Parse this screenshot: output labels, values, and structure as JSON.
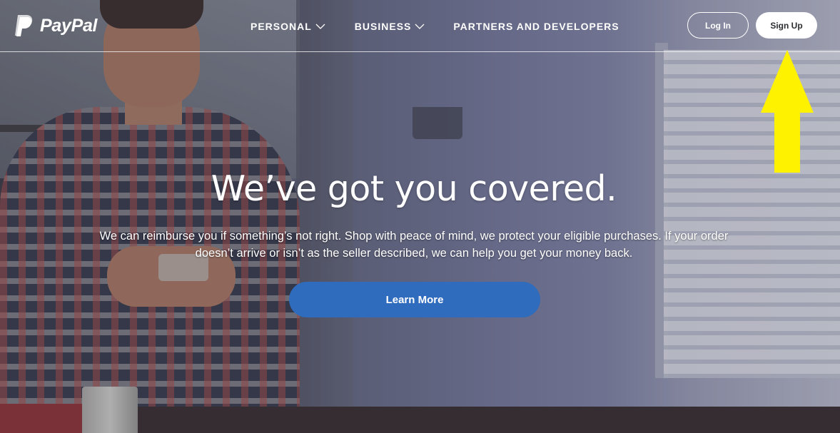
{
  "header": {
    "logo_text": "PayPal",
    "nav": {
      "personal": "PERSONAL",
      "business": "BUSINESS",
      "partners": "PARTNERS AND DEVELOPERS"
    },
    "login_label": "Log In",
    "signup_label": "Sign Up"
  },
  "hero": {
    "title": "We’ve got you covered.",
    "body": "We can reimburse you if something’s not right. Shop with peace of mind, we protect your eligible purchases. If your order doesn’t arrive or isn’t as the seller described, we can help you get your money back.",
    "cta_label": "Learn More"
  },
  "colors": {
    "cta_blue": "#2f6cbd",
    "annotation_arrow": "#fff200",
    "header_text": "#ffffff"
  },
  "icons": {
    "logo": "paypal-logo-icon",
    "dropdown": "chevron-down-icon",
    "annotation": "arrow-up-icon"
  }
}
